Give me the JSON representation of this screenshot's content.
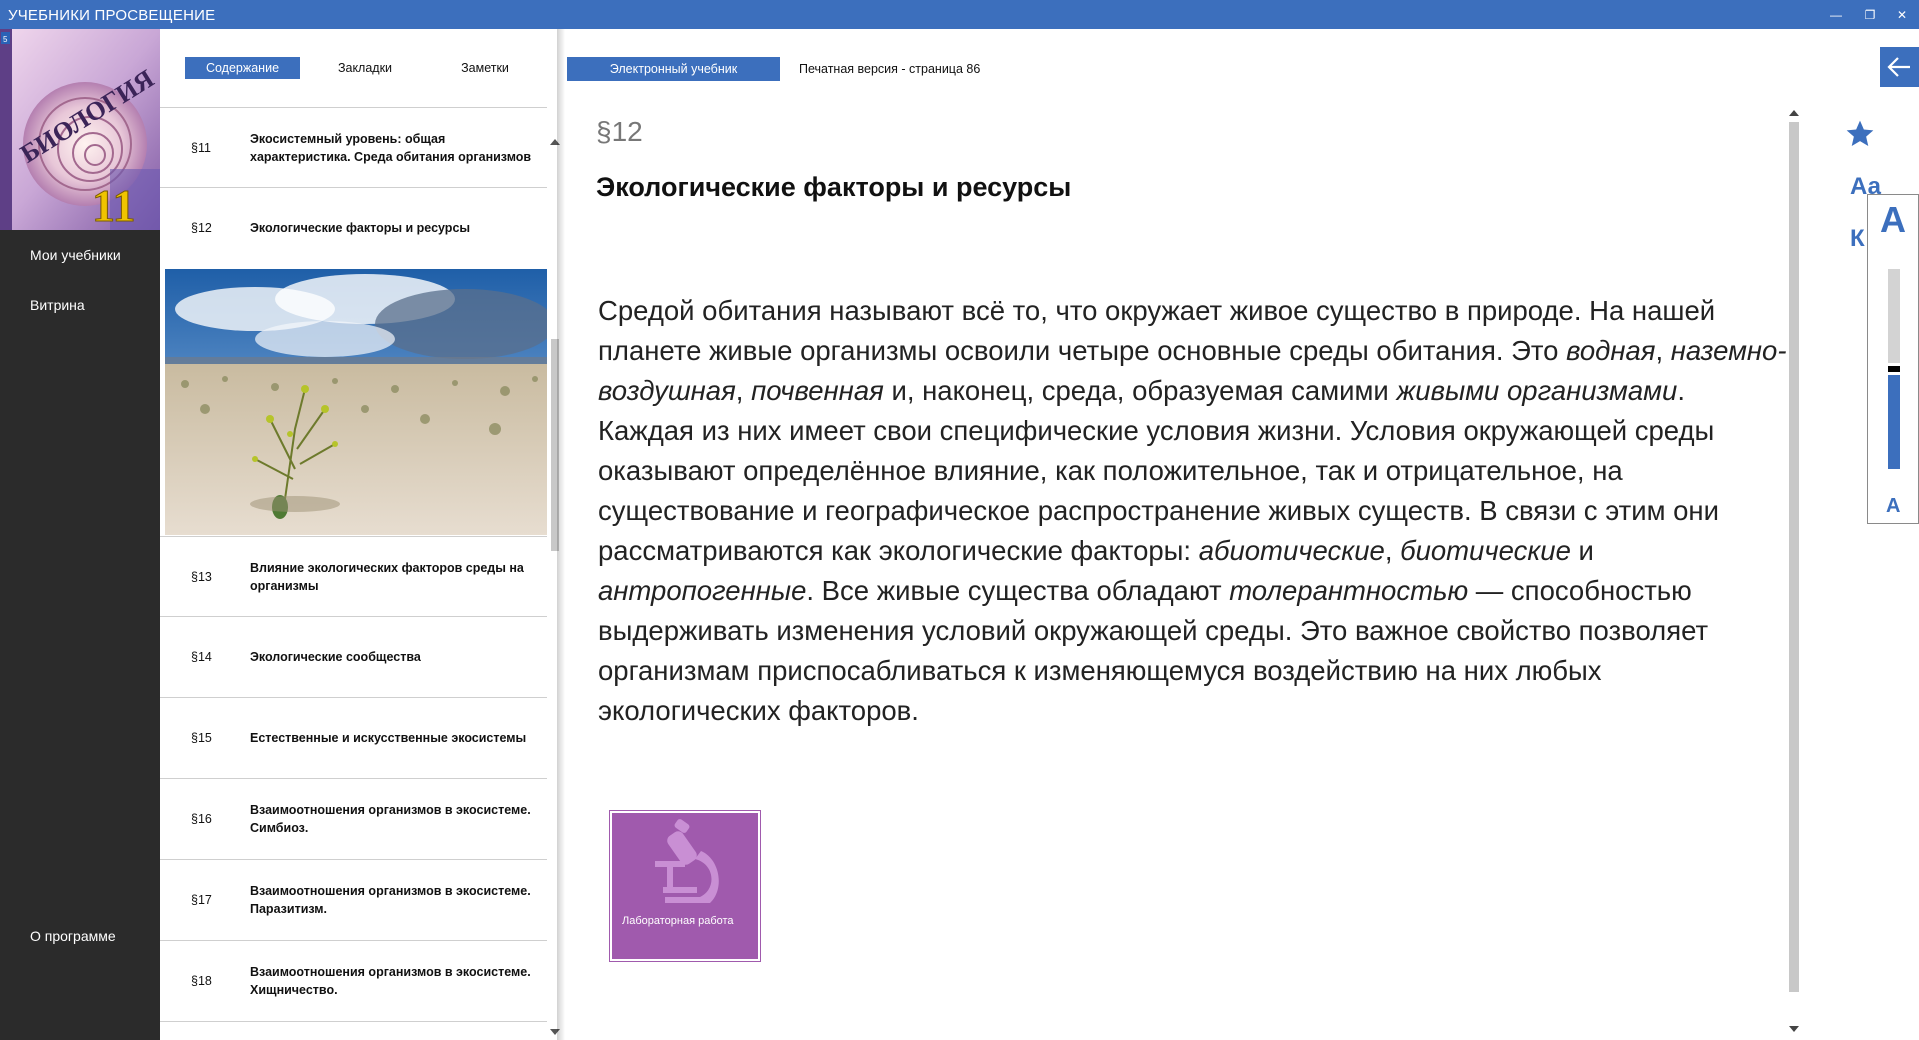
{
  "window": {
    "title": "УЧЕБНИКИ ПРОСВЕЩЕНИЕ"
  },
  "sidebar": {
    "cover": {
      "title": "БИОЛОГИЯ",
      "grade": "11",
      "publisher_mark": "5"
    },
    "nav": [
      {
        "label": "Мои учебники"
      },
      {
        "label": "Витрина"
      },
      {
        "label": "О программе"
      }
    ]
  },
  "toc": {
    "tabs": [
      {
        "label": "Содержание"
      },
      {
        "label": "Закладки"
      },
      {
        "label": "Заметки"
      }
    ],
    "items": [
      {
        "num": "§11",
        "line1": "Экосистемный уровень: общая",
        "line2": "характеристика. Среда обитания организмов"
      },
      {
        "num": "§12",
        "line1": "Экологические факторы и ресурсы",
        "line2": ""
      },
      {
        "num": "§13",
        "line1": "Влияние экологических факторов среды на",
        "line2": "организмы"
      },
      {
        "num": "§14",
        "line1": "Экологические сообщества",
        "line2": ""
      },
      {
        "num": "§15",
        "line1": "Естественные и искусственные экосистемы",
        "line2": ""
      },
      {
        "num": "§16",
        "line1": "Взаимоотношения организмов в экосистеме.",
        "line2": "Симбиоз."
      },
      {
        "num": "§17",
        "line1": "Взаимоотношения организмов в экосистеме.",
        "line2": "Паразитизм."
      },
      {
        "num": "§18",
        "line1": "Взаимоотношения организмов в экосистеме.",
        "line2": "Хищничество."
      }
    ]
  },
  "reader": {
    "tabs": {
      "electronic": "Электронный учебник",
      "print": "Печатная версия - страница 86"
    },
    "paragraph_number": "§12",
    "paragraph_title": "Экологические факторы и ресурсы",
    "body": {
      "s1": "Средой обитания называют всё то, что окружает живое существо в природе. На нашей планете живые организмы освоили четыре основные среды обитания. Это ",
      "i1": "водная",
      "s2": ", ",
      "i2": "наземно-воздушная",
      "s3": ", ",
      "i3": "почвенная",
      "s4": " и, наконец, среда, образуемая самими ",
      "i4": "живыми организмами",
      "s5": ". Каждая из них имеет свои специфические условия жизни. Условия окружающей среды оказывают определённое влияние, как положительное, так и отрицательное, на существование и географическое распространение живых существ. В связи с этим они рассматриваются как экологические факторы: ",
      "i5": "абиотические",
      "s6": ", ",
      "i6": "биотические",
      "s7": " и ",
      "i7": "антропогенные",
      "s8": ". Все живые существа обладают ",
      "i8": "толерантностью",
      "s9": " — способностью выдерживать изменения условий окружающей среды. Это важное свойство позволяет организмам приспосабливаться к изменяющемуся воздействию на них любых экологических факторов."
    },
    "lab_button": {
      "label": "Лабораторная работа",
      "icon": "microscope-icon",
      "color": "#a05aad"
    }
  },
  "toolbar": {
    "bookmark_icon": "star-icon",
    "font_label": "Аа",
    "k_label": "К",
    "font_large": "А",
    "font_small": "А",
    "font_size_level": 0.47
  },
  "colors": {
    "accent": "#3c6fbd",
    "sidebar": "#2b2b2b",
    "lab": "#a05aad"
  }
}
